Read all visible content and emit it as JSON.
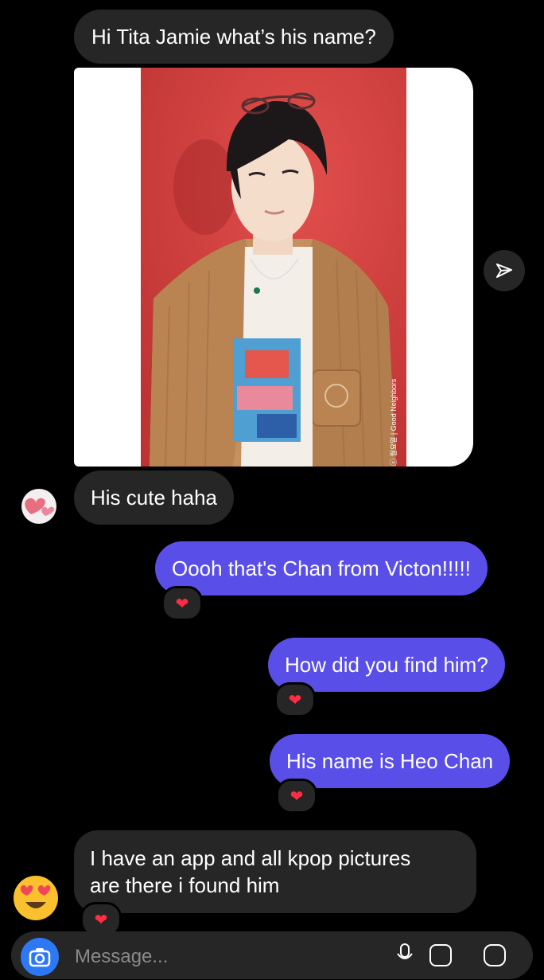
{
  "messages": [
    {
      "text": "Hi Tita Jamie what’s his name?"
    },
    {
      "text": "His cute haha"
    },
    {
      "text": "Oooh that's Chan from Victon!!!!!"
    },
    {
      "text": "How did you find him?"
    },
    {
      "text": "His name is Heo Chan"
    },
    {
      "line1": "I have an app and all kpop pictures",
      "line2": "are there i found him"
    }
  ],
  "reaction": "❤",
  "shared_post": {
    "caption": "ⓒ 월요일 | Good Neighbors"
  },
  "composer": {
    "placeholder": "Message..."
  },
  "colors": {
    "sent_bubble": "#5a4ee8",
    "received_bubble": "#262626",
    "background": "#000000",
    "photo_backdrop": "#d9403f",
    "camera_button": "#2d79f5"
  },
  "icons": [
    "share-icon",
    "camera-icon",
    "microphone-icon",
    "gallery-icon",
    "sticker-icon"
  ]
}
